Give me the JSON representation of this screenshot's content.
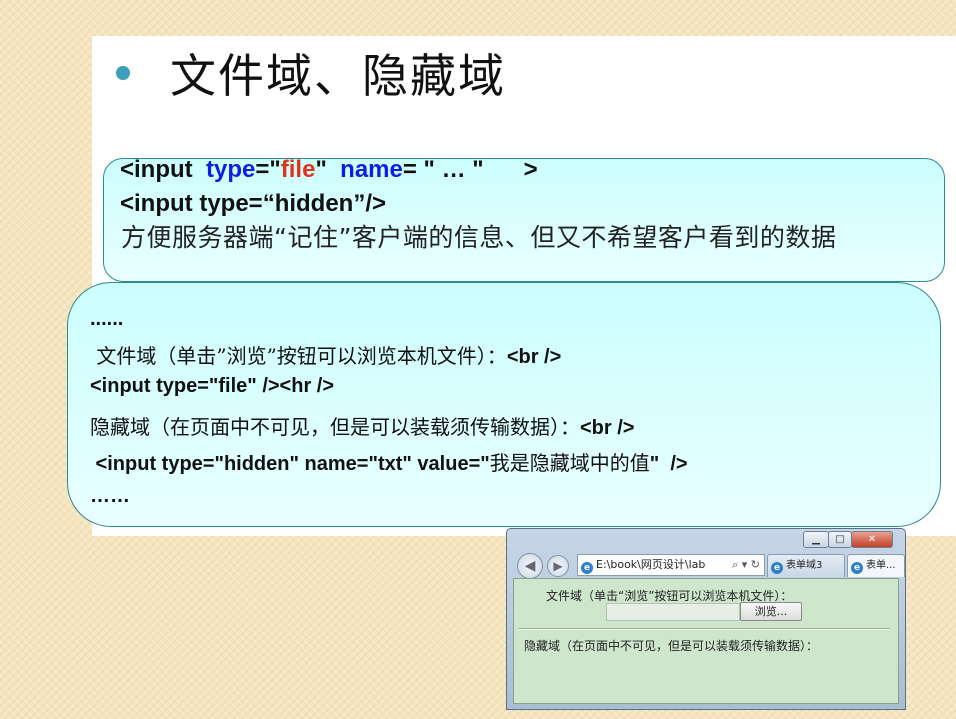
{
  "slide": {
    "title": "文件域、隐藏域"
  },
  "box1": {
    "line1": {
      "p1": "<input  ",
      "p2": "type",
      "p3": "=\"",
      "p4": "file",
      "p5": "\"  ",
      "p6": "name",
      "p7": "= \" … \"      >"
    },
    "line2": "<input type=“hidden”/>",
    "desc": "方便服务器端“记住”客户端的信息、但又不希望客户看到的数据"
  },
  "box2": {
    "line1": "......",
    "line2_cn": " 文件域（单击”浏览”按钮可以浏览本机文件）：",
    "line2_code": "<br />",
    "line3": "<input type=\"file\" /><hr />",
    "line4_cn": "隐藏域（在页面中不可见，但是可以装载须传输数据）：",
    "line4_code": "<br />",
    "line5_a": " <input type=\"hidden\" name=\"txt\" value=\"",
    "line5_cn": "我是隐藏域中的值",
    "line5_b": "\"  />",
    "line6": "……"
  },
  "browser": {
    "address": "E:\\book\\网页设计\\lab",
    "address_icons": "⌕ ▾ ↻",
    "tabs": [
      "表单域3",
      "表单..."
    ],
    "file_label": "文件域（单击“浏览”按钮可以浏览本机文件）：",
    "browse_button": "浏览...",
    "hidden_label": "隐藏域（在页面中不可见，但是可以装载须传输数据）："
  }
}
